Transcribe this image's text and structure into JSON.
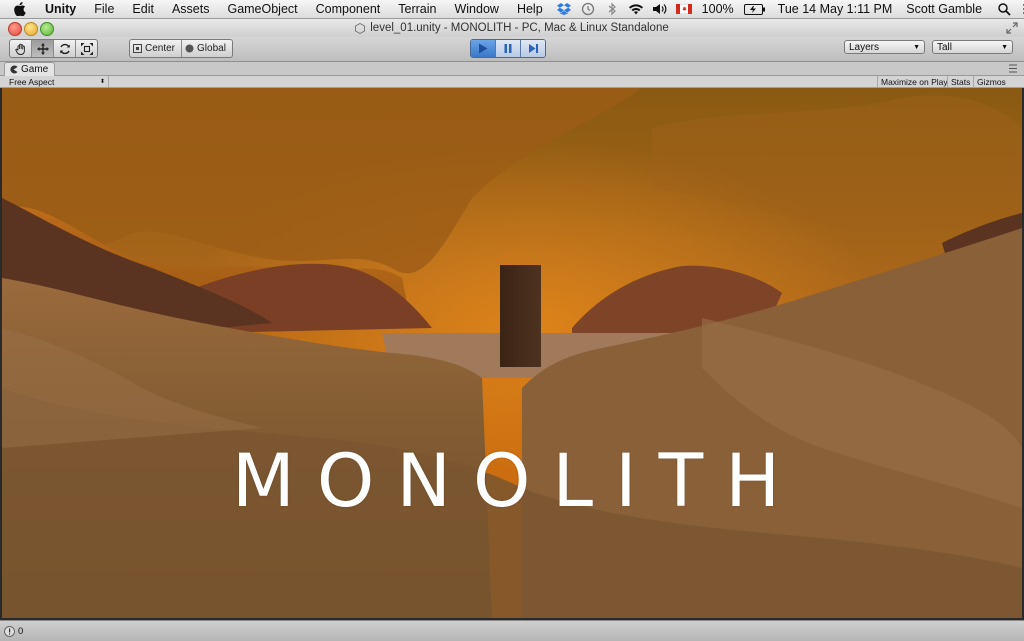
{
  "menubar": {
    "app_name": "Unity",
    "items": [
      "File",
      "Edit",
      "Assets",
      "GameObject",
      "Component",
      "Terrain",
      "Window",
      "Help"
    ],
    "battery": "100%",
    "datetime": "Tue 14 May  1:11 PM",
    "user": "Scott Gamble"
  },
  "window": {
    "title": "level_01.unity - MONOLITH - PC, Mac & Linux Standalone"
  },
  "toolbar": {
    "pivot_mode": "Center",
    "pivot_rotation": "Global",
    "layers_label": "Layers",
    "layout_label": "Tall"
  },
  "game_view": {
    "tab_label": "Game",
    "aspect_label": "Free Aspect",
    "maximize_label": "Maximize on Play",
    "stats_label": "Stats",
    "gizmos_label": "Gizmos",
    "overlay_title": "MONOLITH",
    "sky_color": "#b8620f",
    "ground_color": "#8a5a2a"
  },
  "status": {
    "count": "0"
  }
}
